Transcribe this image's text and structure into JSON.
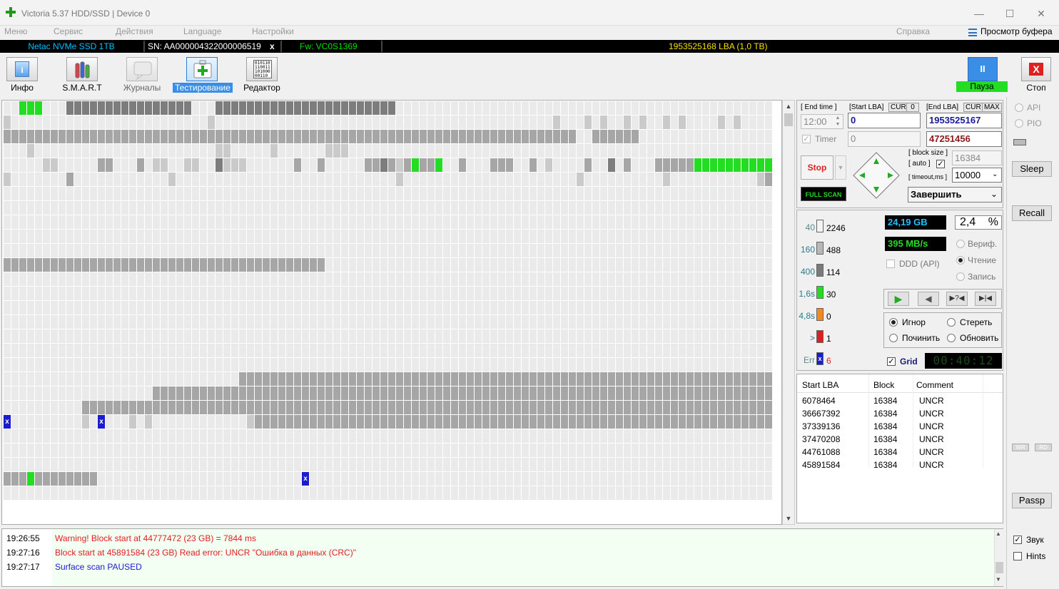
{
  "window": {
    "title": "Victoria 5.37 HDD/SSD | Device 0",
    "buttons": [
      "—",
      "☐",
      "✕"
    ]
  },
  "menu": {
    "items": [
      "Меню",
      "Сервис",
      "Действия",
      "Language",
      "Настройки"
    ],
    "help": "Справка",
    "buffer": "Просмотр буфера"
  },
  "device": {
    "name": "Netac NVMe SSD 1TB",
    "sn": "SN: AA000004322000006519",
    "x": "x",
    "fw": "Fw: VC0S1369",
    "lba": "1953525168 LBA (1,0 TB)"
  },
  "toolbar": {
    "info": "Инфо",
    "smart": "S.M.A.R.T",
    "journals": "Журналы",
    "testing": "Тестирование",
    "editor": "Редактор",
    "pause": "Пауза",
    "pause_icon": "II",
    "stop": "Стоп",
    "stop_icon": "X",
    "editor_icon_lines": [
      "010110",
      "110011",
      "101000",
      "00110"
    ]
  },
  "controls": {
    "end_time_label": "[ End time ]",
    "end_time": "12:00",
    "start_lba_label": "[Start LBA]",
    "cur": "CUR",
    "zero": "0",
    "end_lba_label": "[End LBA]",
    "max": "MAX",
    "start_lba": "0",
    "end_lba": "1953525167",
    "timer_label": "Timer",
    "timer_value": "0",
    "current_lba": "47251456",
    "stop": "Stop",
    "full_scan": "FULL SCAN",
    "block_size_label": "[ block size ]",
    "auto_label": "[ auto ]",
    "timeout_label": "[ timeout,ms ]",
    "block_size": "16384",
    "timeout": "10000",
    "finish_action": "Завершить"
  },
  "legend": [
    {
      "label": "40",
      "count": "2246",
      "color": "#f4f4f4"
    },
    {
      "label": "160",
      "count": "488",
      "color": "#b8b8b8"
    },
    {
      "label": "400",
      "count": "114",
      "color": "#7a7a7a"
    },
    {
      "label": "1,6s",
      "count": "30",
      "color": "#22dd22"
    },
    {
      "label": "4,8s",
      "count": "0",
      "color": "#f28a1e"
    },
    {
      "label": ">",
      "count": "1",
      "color": "#e21d1d"
    },
    {
      "label": "Err",
      "count": "6",
      "color": "#1b1bd0"
    }
  ],
  "stats": {
    "scanned": "24,19 GB",
    "percent": "2,4",
    "percent_unit": "%",
    "speed": "395 MB/s",
    "ddd": "DDD (API)",
    "verify": "Вериф.",
    "read": "Чтение",
    "write": "Запись",
    "grid": "Grid",
    "elapsed": "00:40:12"
  },
  "actions": {
    "ignore": "Игнор",
    "erase": "Стереть",
    "repair": "Починить",
    "refresh": "Обновить"
  },
  "side": {
    "api": "API",
    "pio": "PIO",
    "sleep": "Sleep",
    "recall": "Recall",
    "wr": "WR",
    "rd": "RD",
    "passp": "Passp",
    "sound": "Звук",
    "hints": "Hints"
  },
  "errors_table": {
    "columns": [
      "Start LBA",
      "Block",
      "Comment"
    ],
    "rows": [
      [
        "6078464",
        "16384",
        "UNCR"
      ],
      [
        "36667392",
        "16384",
        "UNCR"
      ],
      [
        "37339136",
        "16384",
        "UNCR"
      ],
      [
        "37470208",
        "16384",
        "UNCR"
      ],
      [
        "44761088",
        "16384",
        "UNCR"
      ],
      [
        "45891584",
        "16384",
        "UNCR"
      ]
    ]
  },
  "log": [
    {
      "time": "19:26:55",
      "msg": "Warning! Block start at 44777472 (23 GB)  = 7844 ms",
      "color": "#e02020"
    },
    {
      "time": "19:27:16",
      "msg": "Block start at 45891584 (23 GB) Read error: UNCR \"Ошибка в данных (CRC)\"",
      "color": "#e02020"
    },
    {
      "time": "19:27:17",
      "msg": "Surface scan PAUSED",
      "color": "#1b1bd0"
    }
  ],
  "scan_grid": {
    "legend": {
      ".": "#eaeaea",
      "l": "#cacaca",
      "m": "#a6a6a6",
      "d": "#7d7d7d",
      "G": "#22dd22",
      "R": "#e21d1d",
      "X": "#1b1bd0"
    },
    "err_mark": "x",
    "rows": [
      "..GGG...dddddddddddddddd...ddddddddddddddddddddddd...............................................................................................................................l........dddddddddd....",
      "l.........................l...........................................l...l.l..l.l..l.l....l.l.....................l..lll...........................l......l..................l........l.........",
      "mmmmmmmmmmmmmmmmmmmmmmmmmmmmmmmmmmmmmmmmmmmmmmmmmmmmmmmmmmmmmmmmmmmmmmmmm..mmmmmm.......................................................mmmmmmmmmmmmmmmmmmm...................................",
      "...l.......................ll.....l......lll.................................................................l...............ll.ll...........l.lll..l..ll.....llll......ll.l....X.........mmmm...",
      ".....ll.....mm...m.ll..ll..dlll......m..m.....mmdmlmGmmG..m...mmm..m.l....m..d.m...mmmmmGGGGGGGGGGGGGGGGGGGGmm.mmmmmmmmmmmmmmmmmmmmmmGmmGGGmmmmmmmmmmmmmmmmmmmGGmmGGmmmmmm...",
      "l.......m............l............................l......................l..........l...........lm.........................l.......l........l.......l..l...l..l.l...l..........l.........l...",
      ".....................................................................................................................................................................l..............l.lll..l..lll.",
      "......................................................................................................................................................................................................",
      ".....................................................................................................................................l................................................................",
      ".........................................................................................................................mmmmmmmmmmmmmmmmmmmmmmmmmmmmmmmmmmmmmmmmmmmmmmmmmmmmmmmmmmmmmmmmmmmmmmmmmmm",
      ".........................................................................................................................................mmmmmmmmmmmmmmmmmmmmmmmmmmmmmmmmmmmmmmmmmmmmmmmmmmmmmmmmmmm",
      "mmmmmmmmmmmmmmmmmmmmmmmmmmmmmmmmmmmmmmmmm.............................................................................................................................................................",
      "......................................................................................................................................................................................................",
      "......................................................................................................................................................................................................",
      "......................................................................................................................................................................................................",
      "......................................................................................................................................................................................................",
      "......................................................................................................................................................................................................",
      "......................................................................................................................................................................................................",
      "......................................................................................................................................................................................................",
      "..............................mmmmmmmmmmmmmmmmmmmmmmmmmmmmmmmmmmmmmmmmmmmmmmmmmmmmmmmmmmmmmmmmmmmmmmmmm..........................................................................................",
      "...................mmmmmmmmmmmmmmmmmmmmmmmmmmmmmmmmmmmmmmmmmmmmmmmmmmmmmmmmmmmmmmmmmmmmmmmmmmmmmmmmmmmmmmmmmmmmmmmmmmmmmmmmmmmmmmm.......................................................................",
      "..........mmmmmmmmmmmmmmmmmmmmmmmmmmmmmmmmmmmmmmmmmmmmmmmmmmmmmmmmmmmmmmmmmmmmmmmmmmmmmmmmmmmmmmmmmmmmmXmmmmmmmmmmmmmmmmmmmmmmmmmmmmmmmmmmmmmmmmmmmmmmmmddddmmmdddmmmmmmmmmmmmmmmmmmmmmm",
      "X.........l.X...l.l............lmmmmmmmmmmmmmmmmmmmmmmmmmmmmmmmmmmmmmmmmmmmmmmmmmmmmmmmmmmmmmmmmmmmmmmmmmmmmmmmmmmmmmm...................................................................................",
      "......................................................................................................................................................................................................",
      "......................................................................................................................................................................................................",
      "...........................................................................................................................................XRdddddddddddddddddddddddddGdddddddddddddd",
      "mmmGmmmmmmmm..........................X...........................................................................................................................................................",
      "......................................................................................................................................................................................................"
    ]
  }
}
